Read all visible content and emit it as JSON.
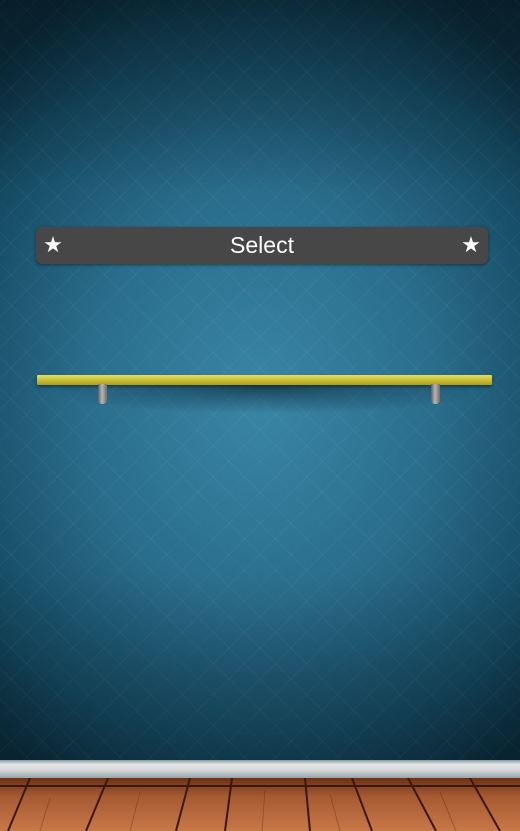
{
  "header": {
    "title": "Select",
    "left_icon": "★",
    "right_icon": "★"
  },
  "colors": {
    "wall": "#2a6d8c",
    "header_bar": "#474747",
    "shelf": "#cfc33a",
    "floor": "#a65a32"
  }
}
